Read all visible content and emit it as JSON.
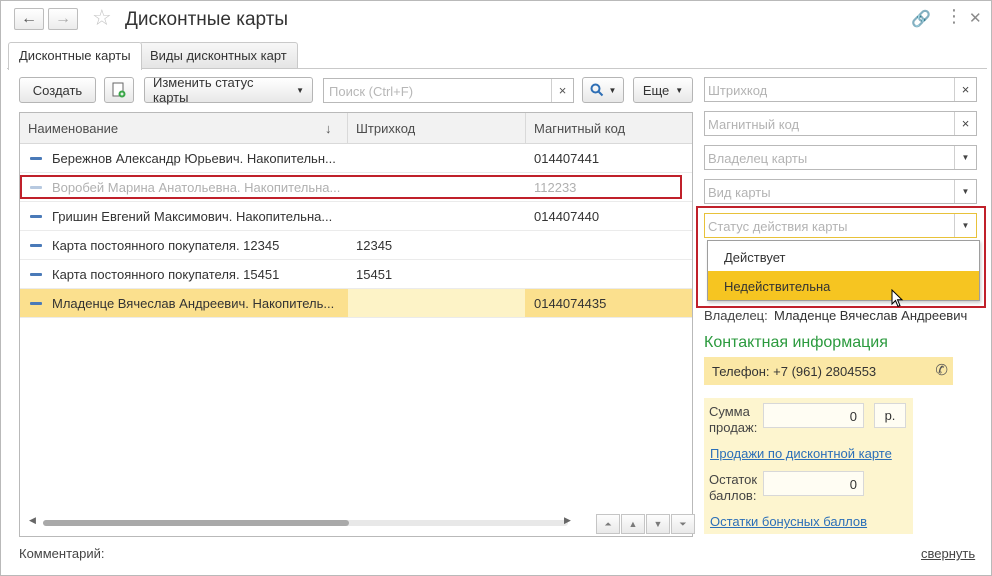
{
  "window": {
    "title": "Дисконтные карты",
    "back_icon": "←",
    "forward_icon": "→"
  },
  "tabs": [
    {
      "label": "Дисконтные карты"
    },
    {
      "label": "Виды дисконтных карт"
    }
  ],
  "toolbar": {
    "create_label": "Создать",
    "change_status_label": "Изменить статус карты",
    "search_placeholder": "Поиск (Ctrl+F)",
    "more_label": "Еще"
  },
  "table": {
    "columns": [
      "Наименование",
      "Штрихкод",
      "Магнитный код"
    ],
    "sort_indicator": "↓",
    "rows": [
      {
        "name": "Бережнов Александр Юрьевич. Накопительн...",
        "barcode": "",
        "magnetic": "014407441",
        "state": "normal"
      },
      {
        "name": "Воробей Марина Анатольевна. Накопительна...",
        "barcode": "",
        "magnetic": "112233",
        "state": "inactive"
      },
      {
        "name": "Гришин Евгений Максимович. Накопительна...",
        "barcode": "",
        "magnetic": "014407440",
        "state": "normal"
      },
      {
        "name": "Карта постоянного покупателя. 12345",
        "barcode": "12345",
        "magnetic": "",
        "state": "normal"
      },
      {
        "name": "Карта постоянного покупателя. 15451",
        "barcode": "15451",
        "magnetic": "",
        "state": "normal"
      },
      {
        "name": "Младенце Вячеслав Андреевич. Накопитель...",
        "barcode": "",
        "magnetic": "0144074435",
        "state": "selected"
      }
    ]
  },
  "filters": {
    "barcode_placeholder": "Штрихкод",
    "magnetic_placeholder": "Магнитный код",
    "owner_placeholder": "Владелец карты",
    "card_type_placeholder": "Вид карты",
    "status_placeholder": "Статус действия карты",
    "status_options": [
      "Действует",
      "Недействительна"
    ]
  },
  "details": {
    "owner_label": "Владелец:",
    "owner_value": "Младенце Вячеслав Андреевич",
    "contact_title": "Контактная информация",
    "phone": "Телефон: +7 (961) 2804553",
    "sales_label": "Сумма продаж:",
    "sales_value": "0",
    "currency": "р.",
    "sales_link": "Продажи по дисконтной карте",
    "bonus_label": "Остаток баллов:",
    "bonus_value": "0",
    "bonus_link": "Остатки бонусных баллов"
  },
  "footer": {
    "comment_label": "Комментарий:",
    "collapse_link": "свернуть"
  },
  "colors": {
    "selection": "#fbe08e",
    "highlight_red": "#c0202a",
    "accent_green": "#2b9a3e",
    "dropdown_hover": "#f6c521"
  }
}
